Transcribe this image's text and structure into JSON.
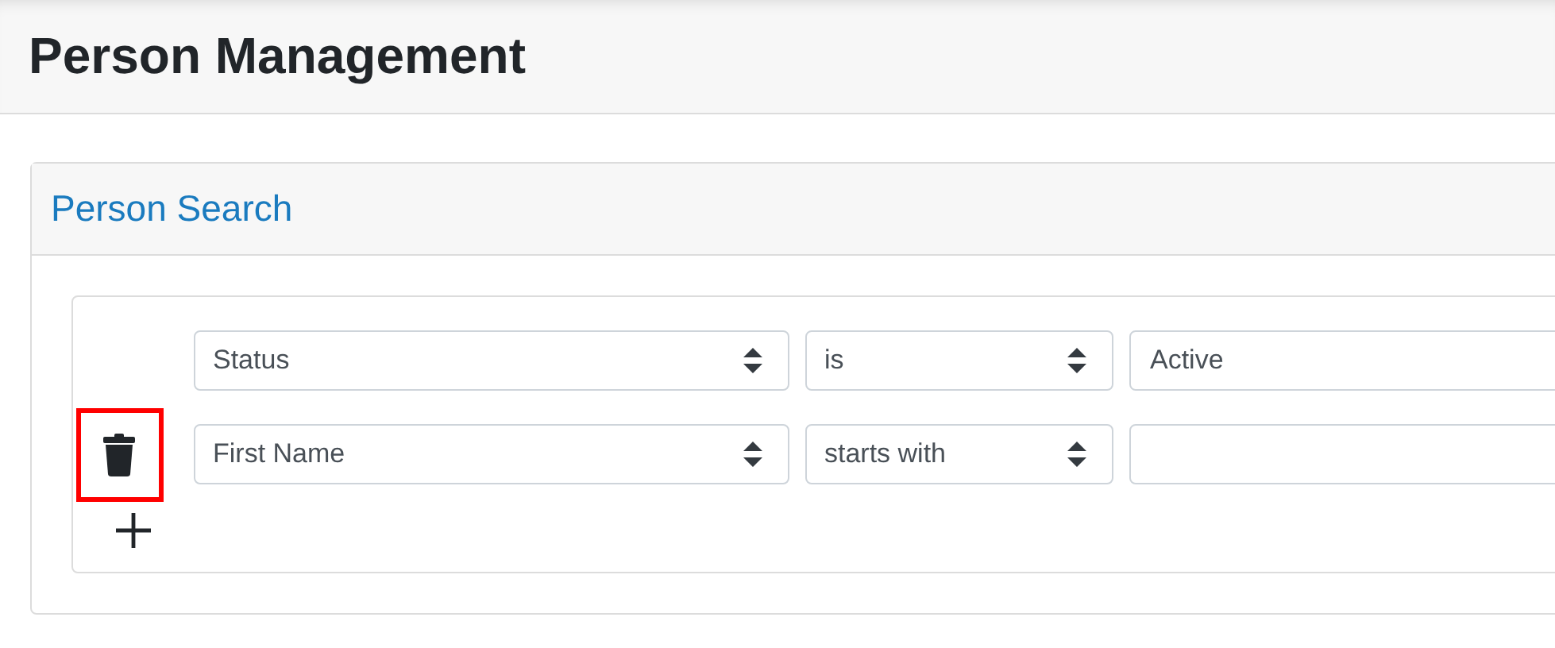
{
  "page": {
    "title": "Person Management"
  },
  "card": {
    "title": "Person Search"
  },
  "criteria": [
    {
      "field": "Status",
      "operator": "is",
      "value": "Active",
      "removable": false
    },
    {
      "field": "First Name",
      "operator": "starts with",
      "removable": true,
      "highlighted": true
    }
  ]
}
